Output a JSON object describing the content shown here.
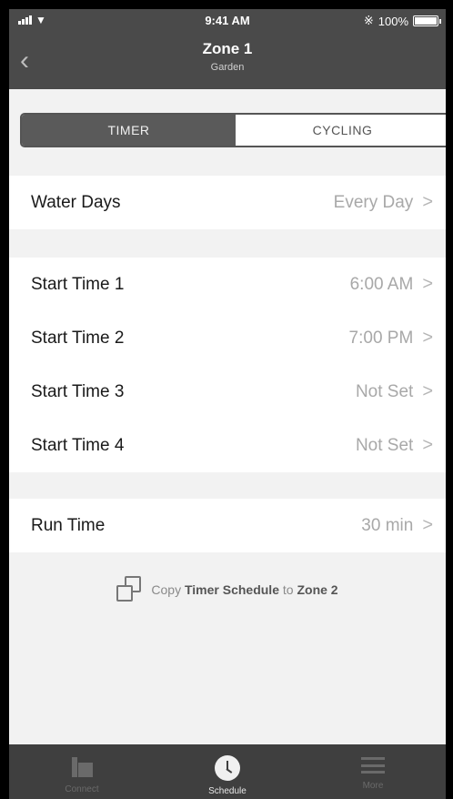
{
  "status_bar": {
    "time": "9:41 AM",
    "battery": "100%",
    "bluetooth_icon": "bluetooth-icon",
    "wifi_icon": "wifi-icon"
  },
  "header": {
    "back_icon": "chevron-left-icon",
    "title": "Zone 1",
    "subtitle": "Garden"
  },
  "segment": {
    "tabs": [
      {
        "label": "TIMER",
        "active": true
      },
      {
        "label": "CYCLING",
        "active": false
      }
    ]
  },
  "water_days": {
    "label": "Water Days",
    "value": "Every Day"
  },
  "start_times": [
    {
      "label": "Start Time 1",
      "value": "6:00 AM"
    },
    {
      "label": "Start Time 2",
      "value": "7:00 PM"
    },
    {
      "label": "Start Time 3",
      "value": "Not Set"
    },
    {
      "label": "Start Time 4",
      "value": "Not Set"
    }
  ],
  "run_time": {
    "label": "Run Time",
    "value": "30 min"
  },
  "copy": {
    "prefix": "Copy",
    "schedule": "Timer Schedule",
    "to": "to",
    "zone": "Zone 2"
  },
  "chevron": ">",
  "tab_bar": [
    {
      "label": "Connect",
      "icon": "connect-icon",
      "active": false
    },
    {
      "label": "Schedule",
      "icon": "clock-icon",
      "active": true
    },
    {
      "label": "More",
      "icon": "menu-icon",
      "active": false
    }
  ],
  "colors": {
    "header_bg": "#4a4a4a",
    "segment_active": "#5a5a5a",
    "tabbar_bg": "#3f3f3f"
  }
}
